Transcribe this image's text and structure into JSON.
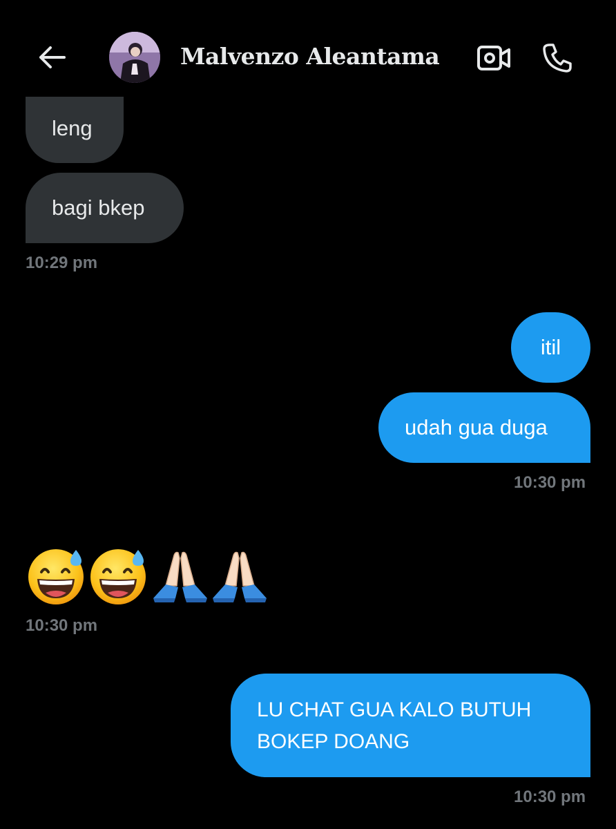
{
  "header": {
    "back_icon": "arrow-left-icon",
    "contact_name": "Malvenzo Aleantama",
    "video_icon": "video-call-icon",
    "call_icon": "phone-icon"
  },
  "colors": {
    "background": "#000000",
    "incoming_bubble": "#2f3336",
    "outgoing_bubble": "#1d9bf0",
    "timestamp": "#71767b",
    "text": "#e7e9ea"
  },
  "messages": [
    {
      "direction": "incoming",
      "text": "leng"
    },
    {
      "direction": "incoming",
      "text": "bagi bkep",
      "time": "10:29 pm"
    },
    {
      "direction": "outgoing",
      "text": "itil"
    },
    {
      "direction": "outgoing",
      "text": "udah gua duga",
      "time": "10:30 pm"
    },
    {
      "direction": "incoming",
      "emojis": [
        "grinning-face-with-sweat",
        "grinning-face-with-sweat",
        "folded-hands",
        "folded-hands"
      ],
      "time": "10:30 pm"
    },
    {
      "direction": "outgoing",
      "text": "LU CHAT GUA KALO BUTUH BOKEP DOANG",
      "time": "10:30 pm"
    }
  ]
}
